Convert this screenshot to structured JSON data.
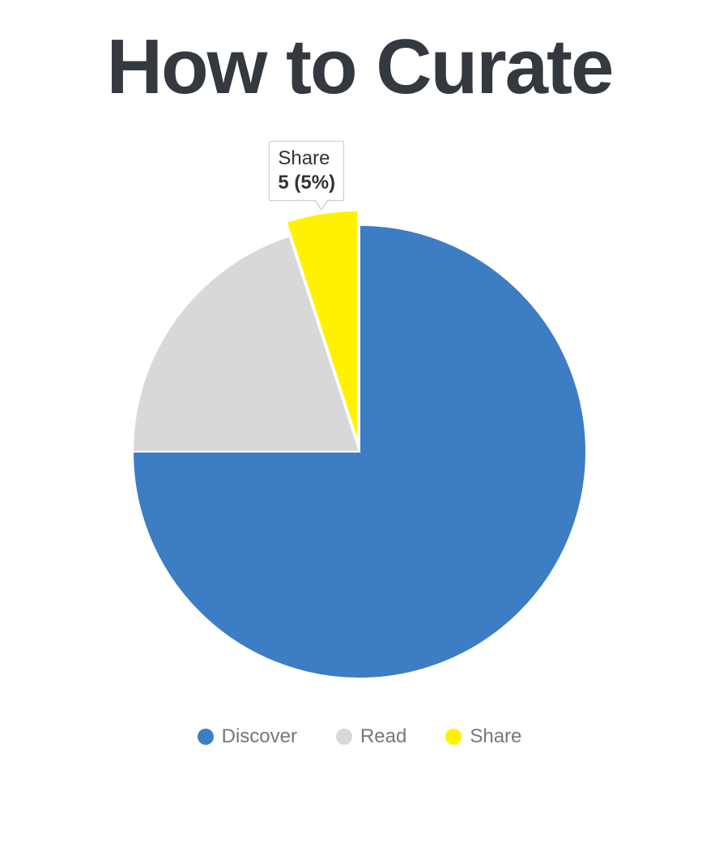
{
  "title": "How to Curate",
  "chart_data": {
    "type": "pie",
    "title": "How to Curate",
    "series": [
      {
        "name": "Discover",
        "value": 75,
        "percent": 75,
        "color": "#3d7dc3"
      },
      {
        "name": "Read",
        "value": 20,
        "percent": 20,
        "color": "#d8d8d8"
      },
      {
        "name": "Share",
        "value": 5,
        "percent": 5,
        "color": "#fff200"
      }
    ],
    "highlighted": {
      "name": "Share",
      "value_label": "5 (5%)"
    },
    "legend_position": "bottom"
  },
  "legend": {
    "items": [
      {
        "label": "Discover",
        "color": "#3d7dc3"
      },
      {
        "label": "Read",
        "color": "#d8d8d8"
      },
      {
        "label": "Share",
        "color": "#fff200"
      }
    ]
  }
}
